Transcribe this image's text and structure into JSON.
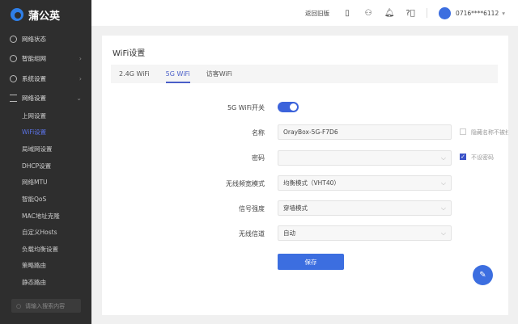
{
  "app": {
    "logo": "蒲公英"
  },
  "sidebar": {
    "items": [
      {
        "label": "网络状态",
        "icon": "globe-icon"
      },
      {
        "label": "智能组网",
        "icon": "network-icon",
        "chevron": "›"
      },
      {
        "label": "系统设置",
        "icon": "gear-icon",
        "chevron": "›"
      },
      {
        "label": "网络设置",
        "icon": "list-icon",
        "chevron": "⌄"
      }
    ],
    "sub": [
      "上网设置",
      "WiFi设置",
      "局域网设置",
      "DHCP设置",
      "网络MTU",
      "智能QoS",
      "MAC地址克隆",
      "自定义Hosts",
      "负载均衡设置",
      "策略路由",
      "静态路由"
    ],
    "search_placeholder": "请输入搜索内容"
  },
  "topbar": {
    "back": "返回旧版",
    "user": "0716****6112",
    "caret": "▾"
  },
  "page": {
    "title": "WiFi设置",
    "tabs": [
      "2.4G WiFi",
      "5G WiFi",
      "访客WiFi"
    ],
    "form": {
      "switch_label": "5G WiFi开关",
      "switch_on": true,
      "name_label": "名称",
      "name_value": "OrayBox-5G-F7D6",
      "hide_label": "隐藏名称不被扫",
      "hide_checked": false,
      "password_label": "密码",
      "password_value": "",
      "nopass_label": "不设密码",
      "nopass_checked": true,
      "bandwidth_label": "无线频宽模式",
      "bandwidth_value": "均衡模式（VHT40）",
      "signal_label": "信号强度",
      "signal_value": "穿墙模式",
      "channel_label": "无线信道",
      "channel_value": "自动",
      "save": "保存"
    }
  }
}
